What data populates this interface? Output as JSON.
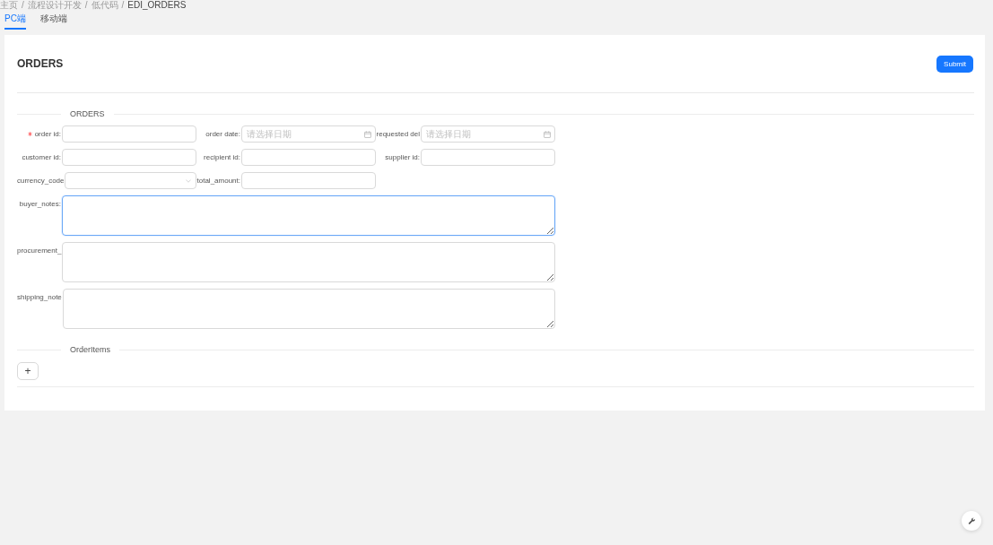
{
  "breadcrumb": {
    "separator": "/",
    "items": [
      "主页",
      "流程设计开发",
      "低代码",
      "EDI_ORDERS"
    ]
  },
  "tabs": [
    {
      "label": "PC端",
      "selected": true
    },
    {
      "label": "移动端",
      "selected": false
    }
  ],
  "form": {
    "title": "ORDERS",
    "submit_label": "Submit",
    "sections": [
      {
        "title": "ORDERS",
        "fields": [
          {
            "kind": "text",
            "label": "order id:",
            "required": true,
            "focused": false
          },
          {
            "kind": "date",
            "label": "order date:",
            "required": false,
            "focused": false,
            "placeholder": "请选择日期"
          },
          {
            "kind": "date",
            "label": "requested del",
            "required": false,
            "focused": false,
            "placeholder": "请选择日期"
          },
          {
            "kind": "text",
            "label": "customer id:",
            "required": false,
            "focused": false
          },
          {
            "kind": "text",
            "label": "recipient id:",
            "required": false,
            "focused": false
          },
          {
            "kind": "text",
            "label": "supplier id:",
            "required": false,
            "focused": false
          },
          {
            "kind": "select",
            "label": "currency_code",
            "required": false,
            "focused": false
          },
          {
            "kind": "text",
            "label": "total_amount:",
            "required": false,
            "focused": false
          },
          {
            "kind": "textarea",
            "label": "buyer_notes:",
            "required": false,
            "focused": true
          },
          {
            "kind": "textarea",
            "label": "procurement_",
            "required": false,
            "focused": false
          },
          {
            "kind": "textarea",
            "label": "shipping_note",
            "required": false,
            "focused": false
          }
        ]
      },
      {
        "title": "OrderItems",
        "add_label": "+"
      }
    ]
  }
}
